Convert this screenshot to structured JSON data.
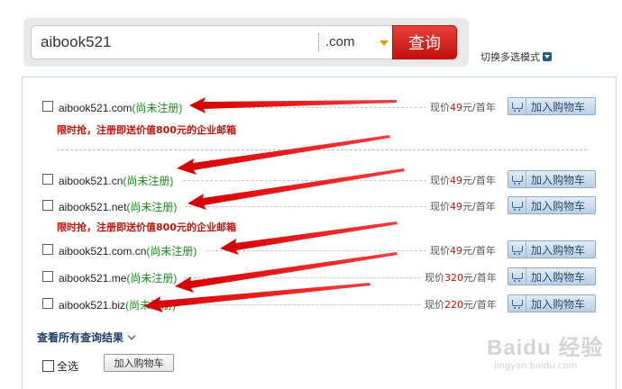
{
  "search": {
    "query": "aibook521",
    "tld": ".com",
    "button_label": "查询",
    "multi_mode_label": "切换多选模式"
  },
  "promo_text": "限时抢，注册即送价值800元的企业邮箱",
  "results": [
    {
      "domain": "aibook521.com",
      "status": "(尚未注册)",
      "price_prefix": "现价",
      "price": "49",
      "price_suffix": "元/首年",
      "cart_label": "加入购物车"
    },
    {
      "domain": "aibook521.cn",
      "status": "(尚未注册)",
      "price_prefix": "现价",
      "price": "49",
      "price_suffix": "元/首年",
      "cart_label": "加入购物车"
    },
    {
      "domain": "aibook521.net",
      "status": "(尚未注册)",
      "price_prefix": "现价",
      "price": "49",
      "price_suffix": "元/首年",
      "cart_label": "加入购物车"
    },
    {
      "domain": "aibook521.com.cn",
      "status": "(尚未注册)",
      "price_prefix": "现价",
      "price": "49",
      "price_suffix": "元/首年",
      "cart_label": "加入购物车"
    },
    {
      "domain": "aibook521.me",
      "status": "(尚未注册)",
      "price_prefix": "现价",
      "price": "320",
      "price_suffix": "元/首年",
      "cart_label": "加入购物车"
    },
    {
      "domain": "aibook521.biz",
      "status": "(尚未注册)",
      "price_prefix": "现价",
      "price": "220",
      "price_suffix": "元/首年",
      "cart_label": "加入购物车"
    }
  ],
  "view_all_label": "查看所有查询结果",
  "select_all_label": "全选",
  "bottom_cart_label": "加入购物车",
  "watermark_text": "Baidu 经验",
  "watermark_url": "jingyan.baidu.com",
  "colors": {
    "accent_red": "#c4100e",
    "status_green": "#1c8a1c",
    "arrow_red": "#e00000"
  }
}
